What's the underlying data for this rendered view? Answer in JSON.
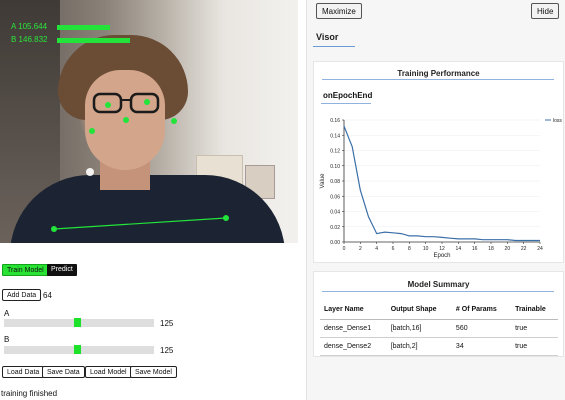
{
  "hud": {
    "a_text": "A   105.644",
    "b_text": "B   146.832",
    "a_value": 105.644,
    "b_value": 146.832
  },
  "controls": {
    "train_label": "Train Model",
    "predict_label": "Predict",
    "add_data_label": "Add Data",
    "data_count": "64",
    "slider_a_label": "A",
    "slider_a_value": "125",
    "slider_b_label": "B",
    "slider_b_value": "125",
    "load_data_label": "Load Data",
    "save_data_label": "Save Data",
    "load_model_label": "Load Model",
    "save_model_label": "Save Model",
    "status": "training finished"
  },
  "visor": {
    "maximize_label": "Maximize",
    "hide_label": "Hide",
    "title": "Visor",
    "training_card_title": "Training Performance",
    "tab_label": "onEpochEnd",
    "summary_card_title": "Model Summary",
    "summary_columns": [
      "Layer Name",
      "Output Shape",
      "# Of Params",
      "Trainable"
    ],
    "summary_rows": [
      [
        "dense_Dense1",
        "[batch,16]",
        "560",
        "true"
      ],
      [
        "dense_Dense2",
        "[batch,2]",
        "34",
        "true"
      ]
    ]
  },
  "colors": {
    "accent_green": "#28e333",
    "hud_green": "#22e43a",
    "chart_line": "#3b6fa8",
    "tab_underline": "#8fb3de"
  },
  "chart_data": {
    "type": "line",
    "xlabel": "Epoch",
    "ylabel": "Value",
    "xlim": [
      0,
      24
    ],
    "ylim": [
      0,
      0.16
    ],
    "x_ticks": [
      0,
      2,
      4,
      6,
      8,
      10,
      12,
      14,
      16,
      18,
      20,
      22,
      24
    ],
    "y_ticks": [
      0.0,
      0.02,
      0.04,
      0.06,
      0.08,
      0.1,
      0.12,
      0.14,
      0.16
    ],
    "y_tick_labels": [
      "0.00",
      "0.02",
      "0.04",
      "0.06",
      "0.08",
      "0.10",
      "0.12",
      "0.14",
      "0.16"
    ],
    "legend_position": "top-right",
    "series": [
      {
        "name": "loss",
        "x": [
          0,
          1,
          2,
          3,
          4,
          5,
          6,
          7,
          8,
          9,
          10,
          11,
          12,
          13,
          14,
          15,
          16,
          17,
          18,
          19,
          20,
          21,
          22,
          23,
          24
        ],
        "y": [
          0.152,
          0.125,
          0.068,
          0.033,
          0.011,
          0.013,
          0.012,
          0.011,
          0.008,
          0.008,
          0.007,
          0.007,
          0.006,
          0.005,
          0.004,
          0.004,
          0.004,
          0.003,
          0.003,
          0.003,
          0.003,
          0.002,
          0.002,
          0.002,
          0.002
        ]
      }
    ]
  }
}
